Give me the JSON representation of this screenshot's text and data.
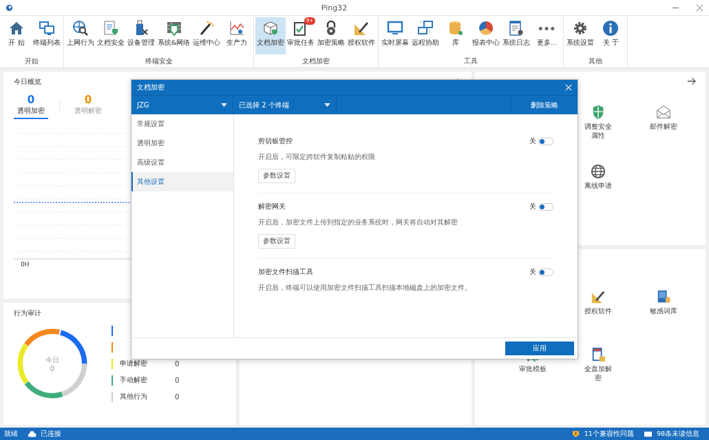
{
  "window": {
    "title": "Ping32"
  },
  "ribbon": {
    "groups": [
      {
        "label": "开始",
        "buttons": [
          {
            "label": "开 始",
            "selected": false
          },
          {
            "label": "终端列表",
            "selected": false
          }
        ]
      },
      {
        "label": "终端安全",
        "buttons": [
          {
            "label": "上网行为",
            "selected": false
          },
          {
            "label": "文档安全",
            "selected": false
          },
          {
            "label": "设备管理",
            "selected": false
          },
          {
            "label": "系统&网络",
            "selected": false
          },
          {
            "label": "运维中心",
            "selected": false
          },
          {
            "label": "生产力",
            "selected": false
          }
        ]
      },
      {
        "label": "文档加密",
        "buttons": [
          {
            "label": "文档加密",
            "selected": true
          },
          {
            "label": "审批任务",
            "selected": false,
            "badge": "9+"
          },
          {
            "label": "加密策略",
            "selected": false
          },
          {
            "label": "授权软件",
            "selected": false
          }
        ]
      },
      {
        "label": "工具",
        "buttons": [
          {
            "label": "实时屏幕",
            "selected": false
          },
          {
            "label": "远程协助",
            "selected": false
          },
          {
            "label": "库",
            "selected": false
          },
          {
            "label": "报表中心",
            "selected": false
          },
          {
            "label": "系统日志",
            "selected": false
          },
          {
            "label": "更多...",
            "selected": false
          }
        ]
      },
      {
        "label": "其他",
        "buttons": [
          {
            "label": "系统设置",
            "selected": false
          },
          {
            "label": "关 于",
            "selected": false
          }
        ]
      }
    ]
  },
  "overview": {
    "title": "今日概览",
    "tabs": [
      {
        "value": "0",
        "label": "透明加密",
        "color": "#1a73e8",
        "selected": true
      },
      {
        "value": "0",
        "label": "透明解密",
        "color": "#f08c00",
        "selected": false
      }
    ],
    "x_label": "0H"
  },
  "audit": {
    "title": "行为审计",
    "center_label": "今日",
    "center_value": "0",
    "legend": [
      {
        "color": "#1a6cf0"
      },
      {
        "color": "#f5871f"
      },
      {
        "label": "申请解密",
        "value": "0",
        "color": "#e8e82a"
      },
      {
        "label": "手动解密",
        "value": "0",
        "color": "#41ad7c"
      },
      {
        "label": "其他行为",
        "value": "0",
        "color": "#d0d0d0"
      }
    ]
  },
  "apps_top": [
    {
      "label": "调整安全属性"
    },
    {
      "label": "邮件解密"
    },
    {
      "label": "离线申请"
    }
  ],
  "apps_bottom": [
    {
      "label": "授权软件"
    },
    {
      "label": "敏感词库"
    },
    {
      "label": "审批模板"
    },
    {
      "label": "全盘加解密"
    }
  ],
  "dialog": {
    "title": "文档加密",
    "group_select": "JZG",
    "terminal_select": "已选择 2 个终端",
    "delete_button": "删除策略",
    "nav": [
      {
        "label": "常规设置",
        "selected": false
      },
      {
        "label": "透明加密",
        "selected": false
      },
      {
        "label": "高级设置",
        "selected": false
      },
      {
        "label": "其他设置",
        "selected": true
      }
    ],
    "settings": [
      {
        "title": "剪切板管控",
        "state_label": "关",
        "on": false,
        "description": "开启后，可限定跨软件复制粘贴的权限",
        "button": "参数设置"
      },
      {
        "title": "解密网关",
        "state_label": "关",
        "on": false,
        "description": "开启后，加密文件上传到指定的业务系统时，网关将自动对其解密",
        "button": "参数设置"
      },
      {
        "title": "加密文件扫描工具",
        "state_label": "关",
        "on": false,
        "description": "开启后，终端可以使用加密文件扫描工具扫描本地磁盘上的加密文件。"
      }
    ],
    "apply_button": "应用"
  },
  "status_bar": {
    "ready": "就绪",
    "connection": "已连接",
    "issues": "11个兼容性问题",
    "messages": "98条未读信息"
  }
}
